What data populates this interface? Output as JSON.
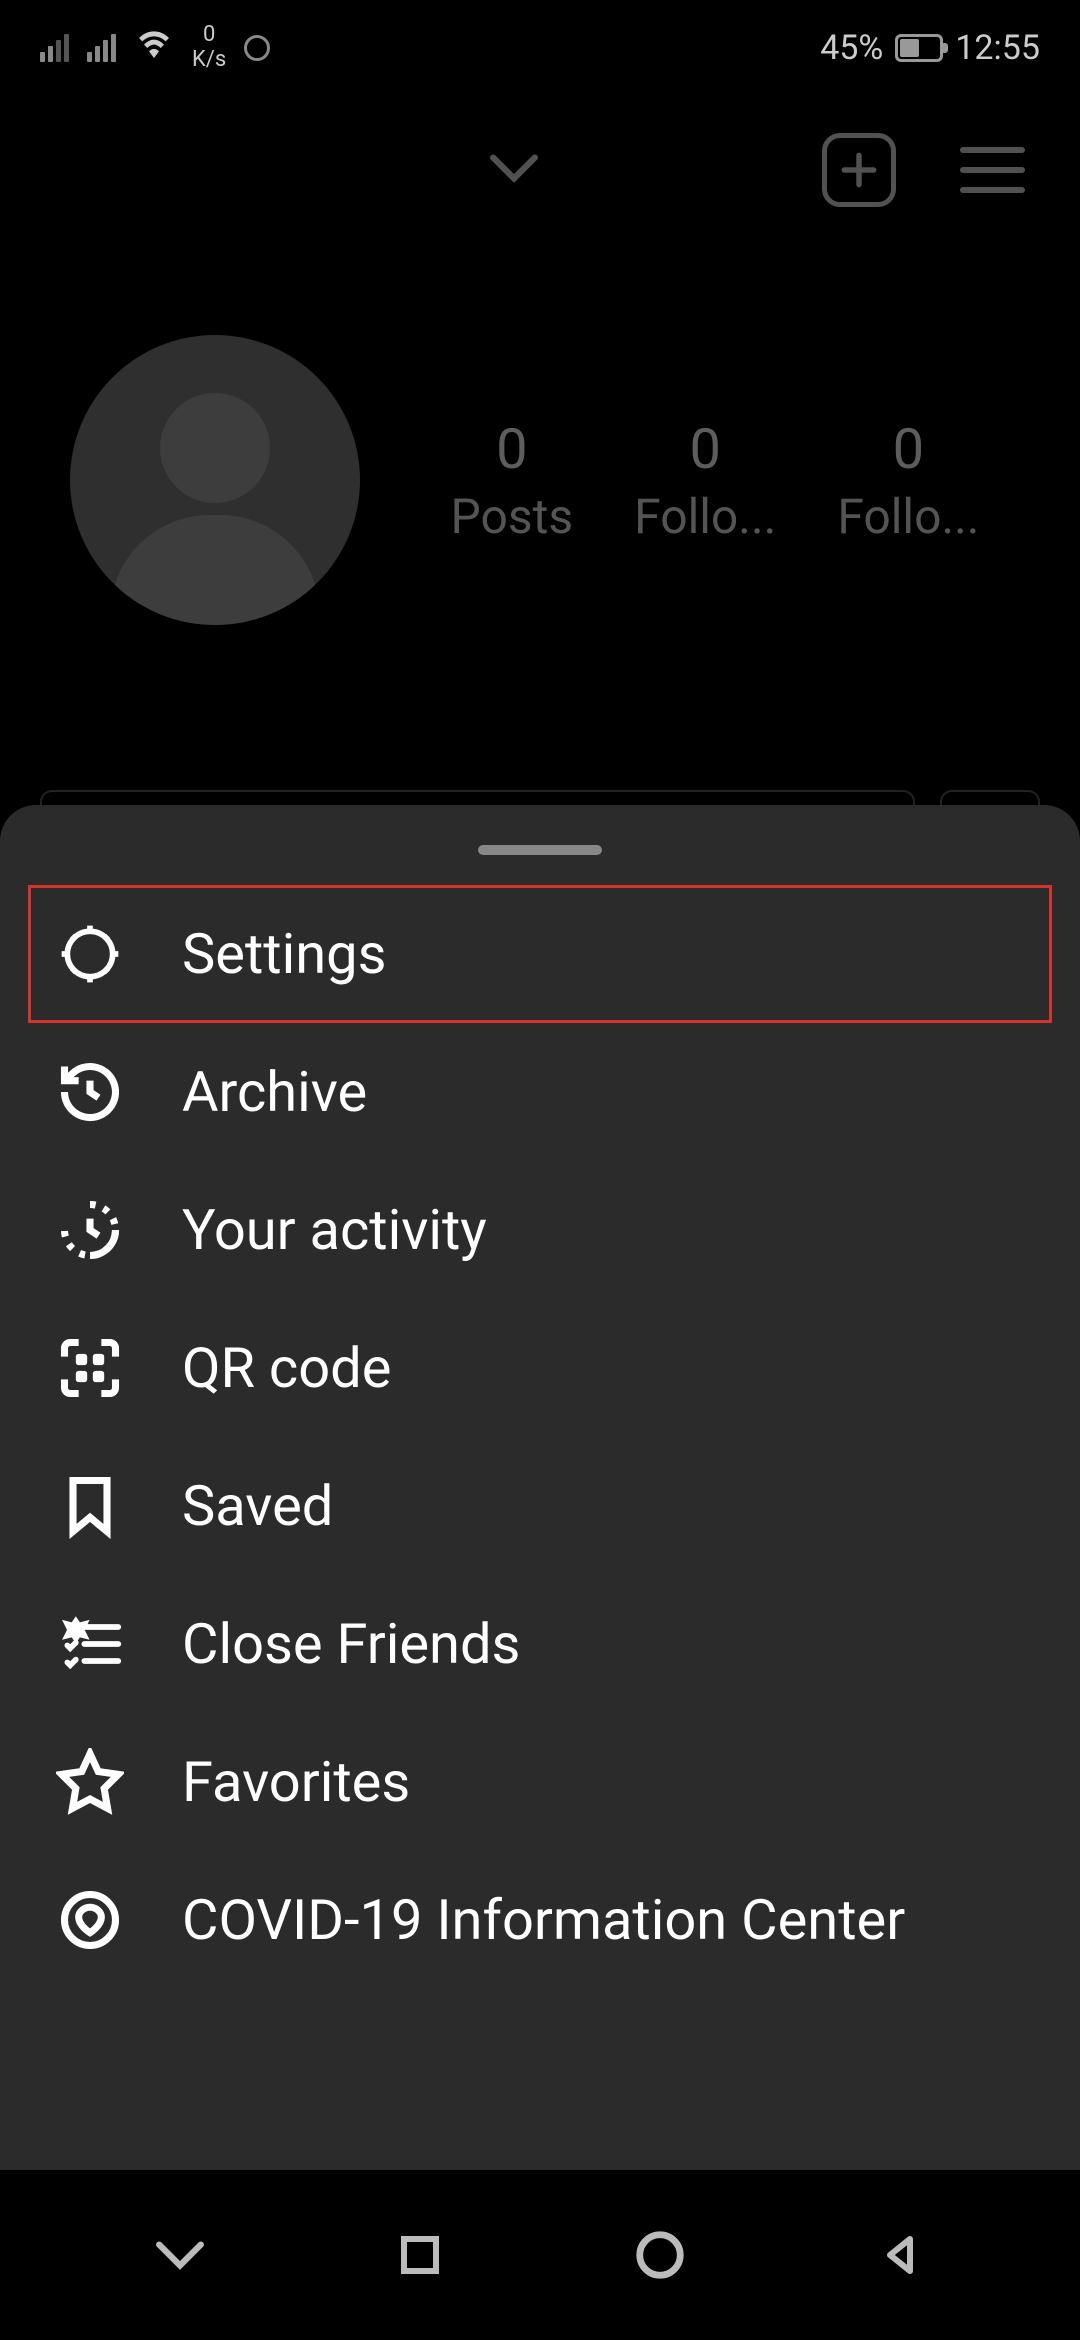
{
  "status": {
    "speed_value": "0",
    "speed_unit": "K/s",
    "battery_pct": "45%",
    "time": "12:55"
  },
  "profile": {
    "stats": [
      {
        "value": "0",
        "label": "Posts"
      },
      {
        "value": "0",
        "label": "Follo..."
      },
      {
        "value": "0",
        "label": "Follo..."
      }
    ]
  },
  "menu": {
    "items": [
      {
        "label": "Settings",
        "icon": "gear",
        "highlighted": true
      },
      {
        "label": "Archive",
        "icon": "history"
      },
      {
        "label": "Your activity",
        "icon": "activity"
      },
      {
        "label": "QR code",
        "icon": "qr"
      },
      {
        "label": "Saved",
        "icon": "bookmark"
      },
      {
        "label": "Close Friends",
        "icon": "close-friends"
      },
      {
        "label": "Favorites",
        "icon": "star"
      },
      {
        "label": "COVID-19 Information Center",
        "icon": "covid"
      }
    ]
  },
  "colors": {
    "highlight_border": "#d6332d",
    "sheet_bg": "#2b2b2b"
  }
}
